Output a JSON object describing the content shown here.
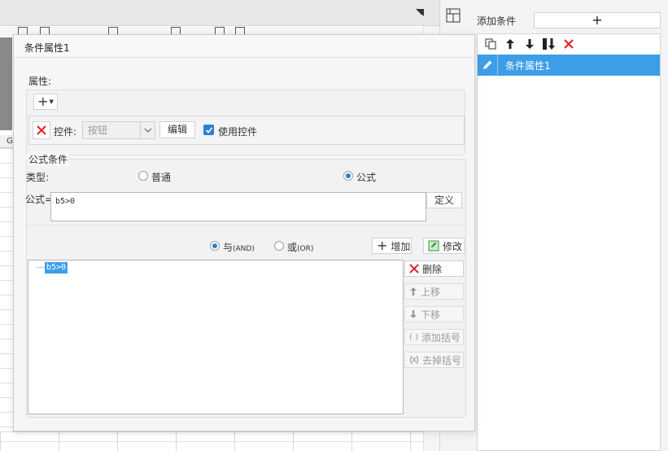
{
  "right_panel": {
    "add_condition_label": "添加条件",
    "add_condition_button": "+",
    "toolbar_icons": [
      "copy-icon",
      "arrow-up-icon",
      "arrow-down-icon",
      "sort-down-icon",
      "delete-icon"
    ],
    "conditions": [
      {
        "label": "条件属性1",
        "selected": true,
        "icon": "pencil-icon"
      }
    ]
  },
  "background": {
    "column_header": "G"
  },
  "dialog": {
    "title": "条件属性1",
    "properties": {
      "legend": "属性:",
      "add_button": "+",
      "control_label": "控件:",
      "control_value": "按钮",
      "edit_button": "编辑",
      "use_control_label": "使用控件",
      "use_control_checked": true
    },
    "formula_condition": {
      "legend": "公式条件",
      "type_label": "类型:",
      "type_options": [
        {
          "label": "普通",
          "selected": false
        },
        {
          "label": "公式",
          "selected": true
        }
      ],
      "formula_label": "公式=",
      "formula_value": "b5>0",
      "define_button": "定义",
      "logic_and_label": "与",
      "logic_and_code": "(AND)",
      "logic_or_label": "或",
      "logic_or_code": "(OR)",
      "logic_selected": "AND",
      "add_button": "增加",
      "modify_button": "修改",
      "delete_button": "删除",
      "move_up_button": "上移",
      "move_down_button": "下移",
      "add_paren_button": "添加括号",
      "remove_paren_button": "去掉括号",
      "tree_items": [
        "b5>0"
      ]
    }
  },
  "colors": {
    "accent": "#3d9ee8",
    "delete_red": "#e02424",
    "checkbox_blue": "#2e7fd6"
  }
}
